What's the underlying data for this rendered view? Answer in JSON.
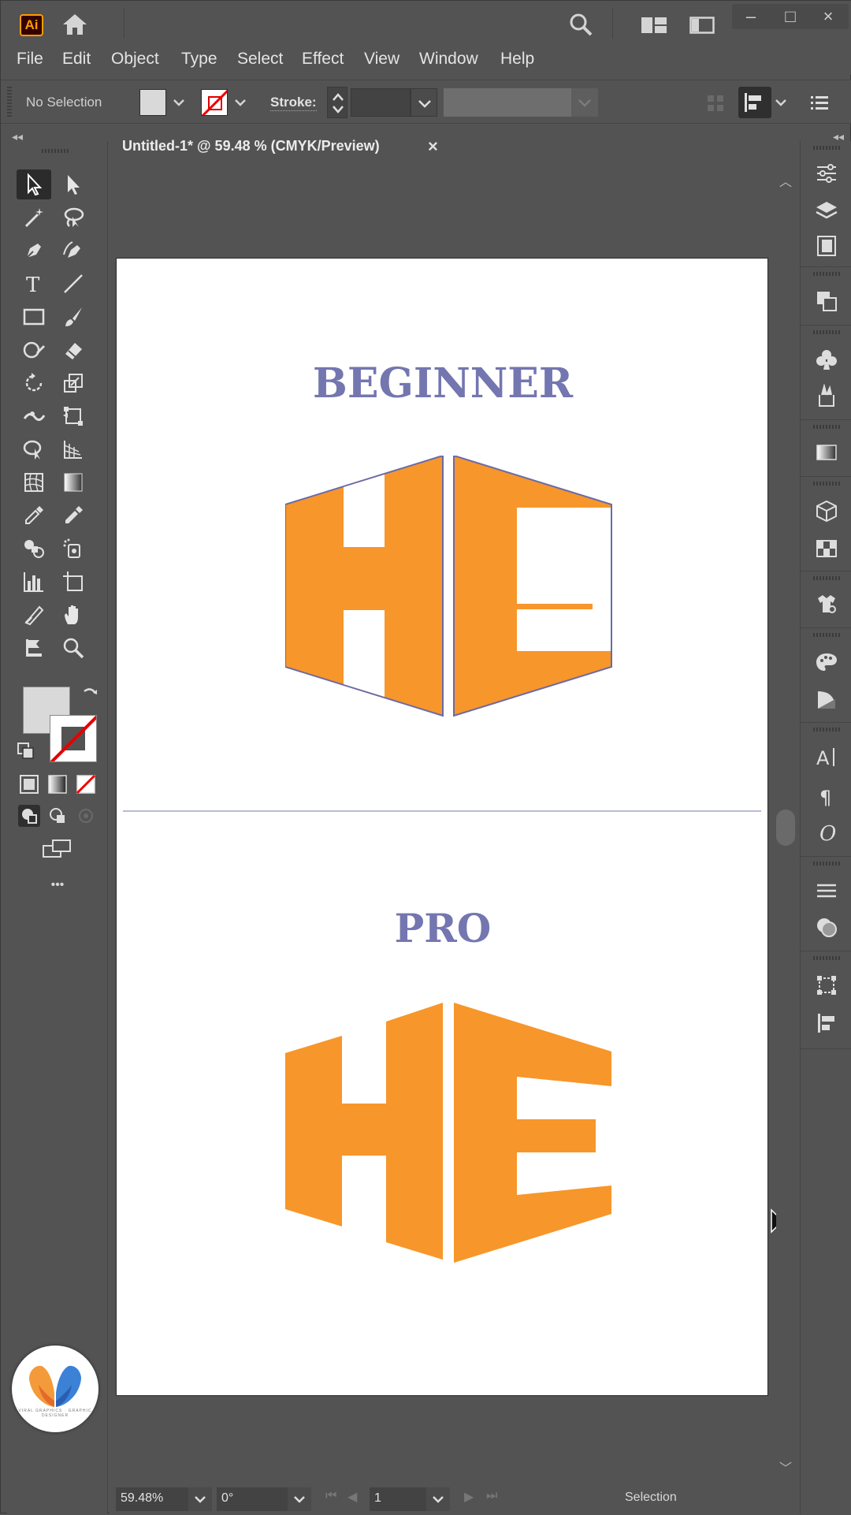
{
  "app": {
    "logo_text": "Ai",
    "window_controls": {
      "minimize": "–",
      "maximize": "□",
      "close": "×"
    }
  },
  "menu": {
    "items": [
      "File",
      "Edit",
      "Object",
      "Type",
      "Select",
      "Effect",
      "View",
      "Window",
      "Help"
    ]
  },
  "control_bar": {
    "selection_label": "No Selection",
    "stroke_label": "Stroke:",
    "stroke_value": "",
    "fill_color": "#d9d9d9"
  },
  "document": {
    "tab_title": "Untitled-1* @ 59.48 % (CMYK/Preview)",
    "tab_close": "×"
  },
  "artboard": {
    "heading_top": "BEGINNER",
    "heading_bottom": "PRO",
    "logo_color": "#f7962a",
    "outline_color": "#6a6aa8",
    "heading_color": "#7476b0"
  },
  "tools": {
    "more_label": "•••"
  },
  "status_bar": {
    "zoom": "59.48%",
    "rotation": "0°",
    "page": "1",
    "status": "Selection"
  },
  "badge": {
    "text": "VIRAL GRAPHICS · GRAPHIC DESIGNER"
  }
}
